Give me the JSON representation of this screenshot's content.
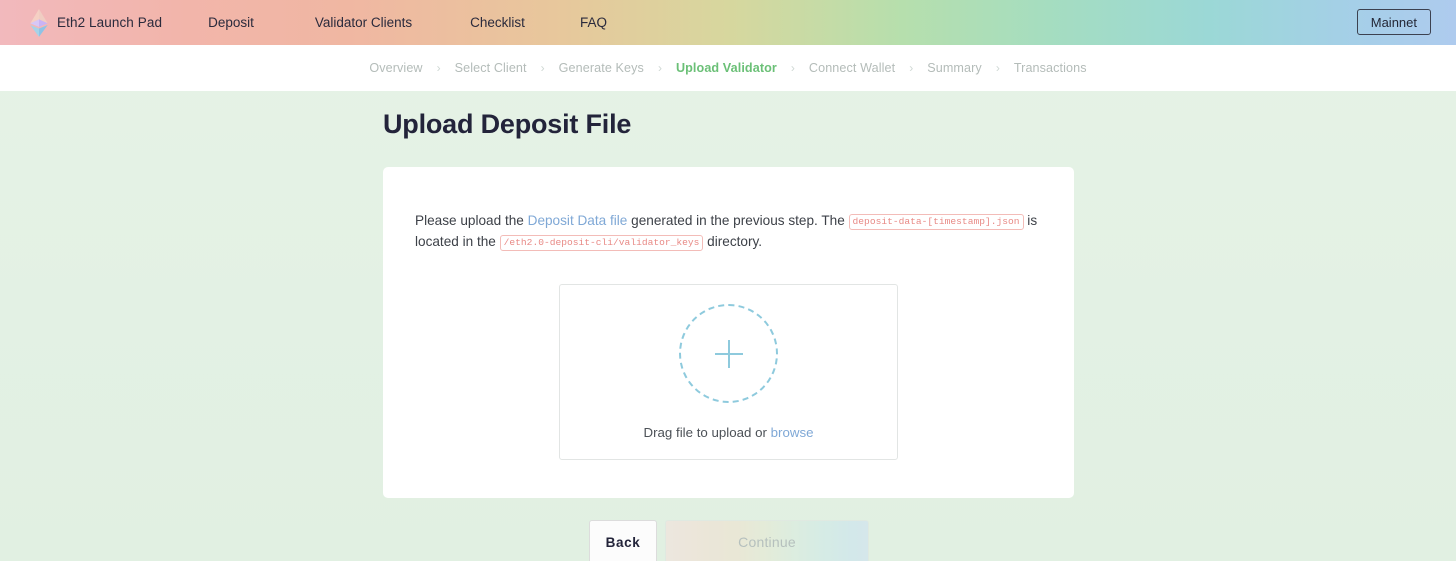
{
  "header": {
    "logo_icon": "ethereum-diamond-icon",
    "brand": "Eth2 Launch Pad",
    "nav": [
      {
        "label": "Deposit"
      },
      {
        "label": "Validator Clients"
      },
      {
        "label": "Checklist"
      },
      {
        "label": "FAQ"
      }
    ],
    "network_badge": "Mainnet"
  },
  "breadcrumb": {
    "separator": "›",
    "steps": [
      {
        "label": "Overview",
        "active": false
      },
      {
        "label": "Select Client",
        "active": false
      },
      {
        "label": "Generate Keys",
        "active": false
      },
      {
        "label": "Upload Validator",
        "active": true
      },
      {
        "label": "Connect Wallet",
        "active": false
      },
      {
        "label": "Summary",
        "active": false
      },
      {
        "label": "Transactions",
        "active": false
      }
    ]
  },
  "main": {
    "title": "Upload Deposit File",
    "instructions": {
      "part1": "Please upload the ",
      "link_text": "Deposit Data file",
      "part2": " generated in the previous step. The ",
      "code1": "deposit-data-[timestamp].json",
      "part3": " is located in the ",
      "code2": "/eth2.0-deposit-cli/validator_keys",
      "part4": " directory."
    },
    "dropzone": {
      "plus_icon": "plus-icon",
      "label_prefix": "Drag file to upload or ",
      "browse_link": "browse"
    }
  },
  "actions": {
    "back_label": "Back",
    "continue_label": "Continue"
  },
  "colors": {
    "accent_green": "#6bc077",
    "link_blue": "#7fa8d6",
    "code_red": "#e88a86",
    "dropzone_blue": "#8ecadd",
    "page_bg": "#e4f2e4"
  }
}
